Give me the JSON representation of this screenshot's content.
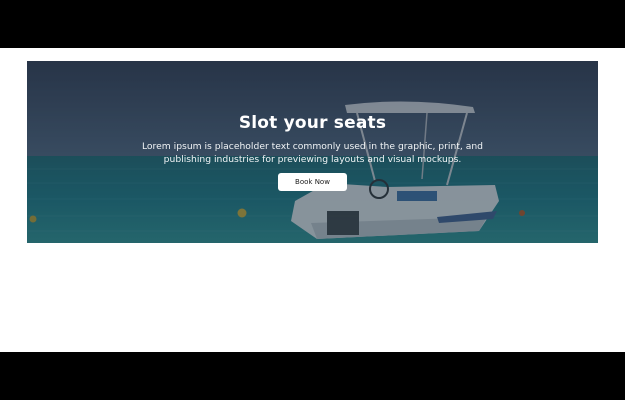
{
  "banner": {
    "title": "Slot your seats",
    "description": "Lorem ipsum is placeholder text commonly used in the graphic, print, and publishing industries for previewing layouts and visual mockups.",
    "button_label": "Book Now",
    "background_image": "boat-on-sea-photo"
  },
  "colors": {
    "overlay": "#2a3a4c",
    "sea": "#1d6f7a",
    "sky": "#3a4a62",
    "button_bg": "#ffffff"
  }
}
